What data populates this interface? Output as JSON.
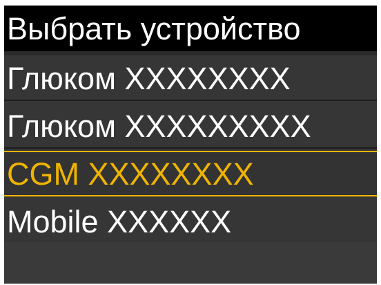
{
  "header": {
    "title": "Выбрать устройство"
  },
  "devices": [
    {
      "label": "Глюком XXXXXXXX",
      "selected": false
    },
    {
      "label": "Глюком XXXXXXXXX",
      "selected": false
    },
    {
      "label": "CGM XXXXXXXX",
      "selected": true
    },
    {
      "label": "Mobile XXXXXX",
      "selected": false
    }
  ],
  "colors": {
    "background": "#363636",
    "header": "#000000",
    "text": "#ffffff",
    "highlight": "#f0b400"
  }
}
